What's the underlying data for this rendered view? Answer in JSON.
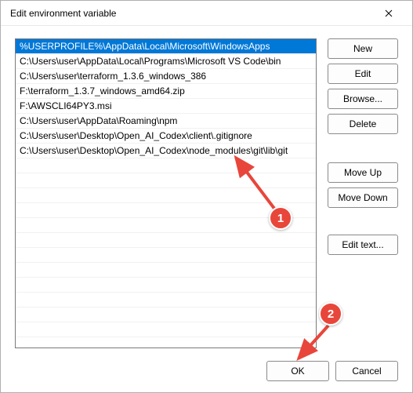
{
  "window": {
    "title": "Edit environment variable"
  },
  "list": {
    "items": [
      "%USERPROFILE%\\AppData\\Local\\Microsoft\\WindowsApps",
      "C:\\Users\\user\\AppData\\Local\\Programs\\Microsoft VS Code\\bin",
      "C:\\Users\\user\\terraform_1.3.6_windows_386",
      "F:\\terraform_1.3.7_windows_amd64.zip",
      "F:\\AWSCLI64PY3.msi",
      "C:\\Users\\user\\AppData\\Roaming\\npm",
      "C:\\Users\\user\\Desktop\\Open_AI_Codex\\client\\.gitignore",
      "C:\\Users\\user\\Desktop\\Open_AI_Codex\\node_modules\\git\\lib\\git"
    ],
    "selected_index": 0
  },
  "buttons": {
    "new": "New",
    "edit": "Edit",
    "browse": "Browse...",
    "delete": "Delete",
    "move_up": "Move Up",
    "move_down": "Move Down",
    "edit_text": "Edit text...",
    "ok": "OK",
    "cancel": "Cancel"
  },
  "annotations": {
    "badge1": "1",
    "badge2": "2"
  }
}
